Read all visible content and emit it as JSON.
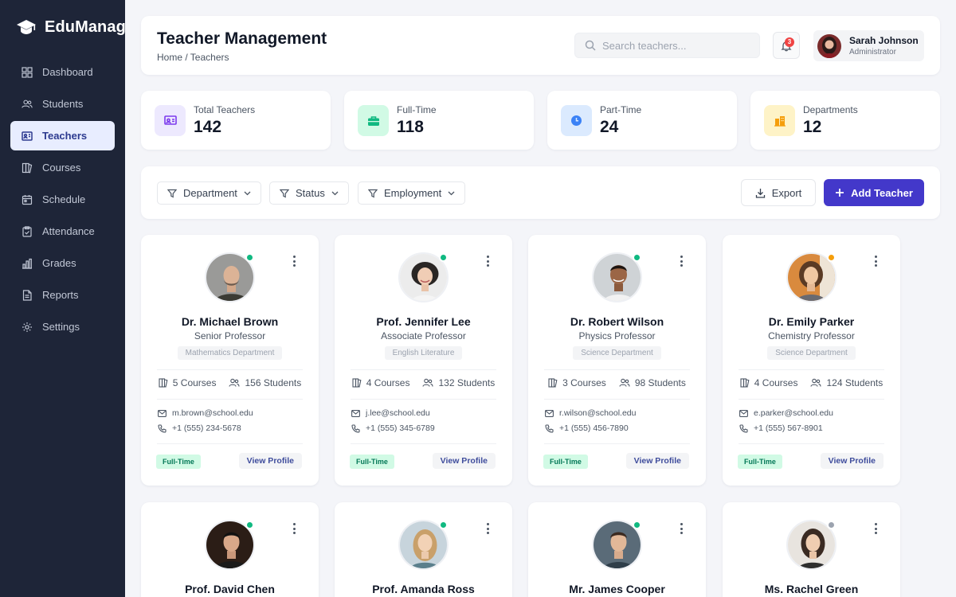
{
  "app": {
    "brand": "EduManage"
  },
  "sidebar": {
    "items": [
      {
        "label": "Dashboard",
        "icon": "dashboard-icon"
      },
      {
        "label": "Students",
        "icon": "users-icon"
      },
      {
        "label": "Teachers",
        "icon": "teacher-icon",
        "active": true
      },
      {
        "label": "Courses",
        "icon": "book-icon"
      },
      {
        "label": "Schedule",
        "icon": "calendar-icon"
      },
      {
        "label": "Attendance",
        "icon": "clipboard-icon"
      },
      {
        "label": "Grades",
        "icon": "bar-chart-icon"
      },
      {
        "label": "Reports",
        "icon": "document-icon"
      },
      {
        "label": "Settings",
        "icon": "gear-icon"
      }
    ]
  },
  "header": {
    "title": "Teacher Management",
    "breadcrumb": "Home / Teachers",
    "search_placeholder": "Search teachers...",
    "notifications": "3",
    "user": {
      "name": "Sarah Johnson",
      "role": "Administrator"
    }
  },
  "stats": [
    {
      "label": "Total Teachers",
      "value": "142",
      "icon": "teacher-board-icon",
      "color": "#ede9fe",
      "accent": "#7c3aed"
    },
    {
      "label": "Full-Time",
      "value": "118",
      "icon": "briefcase-icon",
      "color": "#d1fae5",
      "accent": "#10b981"
    },
    {
      "label": "Part-Time",
      "value": "24",
      "icon": "clock-icon",
      "color": "#dbeafe",
      "accent": "#3b82f6"
    },
    {
      "label": "Departments",
      "value": "12",
      "icon": "building-icon",
      "color": "#fef3c7",
      "accent": "#f59e0b"
    }
  ],
  "filters": {
    "department": "Department",
    "status": "Status",
    "employment": "Employment",
    "export": "Export",
    "add": "Add Teacher"
  },
  "teachers": [
    {
      "name": "Dr. Michael Brown",
      "title": "Senior Professor",
      "dept": "Mathematics Department",
      "courses": "5 Courses",
      "students": "156 Students",
      "email": "m.brown@school.edu",
      "phone": "+1 (555) 234-5678",
      "employment": "Full-Time",
      "action": "View Profile",
      "status_color": "#10b981"
    },
    {
      "name": "Prof. Jennifer Lee",
      "title": "Associate Professor",
      "dept": "English Literature",
      "courses": "4 Courses",
      "students": "132 Students",
      "email": "j.lee@school.edu",
      "phone": "+1 (555) 345-6789",
      "employment": "Full-Time",
      "action": "View Profile",
      "status_color": "#10b981"
    },
    {
      "name": "Dr. Robert Wilson",
      "title": "Physics Professor",
      "dept": "Science Department",
      "courses": "3 Courses",
      "students": "98 Students",
      "email": "r.wilson@school.edu",
      "phone": "+1 (555) 456-7890",
      "employment": "Full-Time",
      "action": "View Profile",
      "status_color": "#10b981"
    },
    {
      "name": "Dr. Emily Parker",
      "title": "Chemistry Professor",
      "dept": "Science Department",
      "courses": "4 Courses",
      "students": "124 Students",
      "email": "e.parker@school.edu",
      "phone": "+1 (555) 567-8901",
      "employment": "Full-Time",
      "action": "View Profile",
      "status_color": "#f59e0b"
    },
    {
      "name": "Prof. David Chen",
      "status_color": "#10b981"
    },
    {
      "name": "Prof. Amanda Ross",
      "status_color": "#10b981"
    },
    {
      "name": "Mr. James Cooper",
      "status_color": "#10b981"
    },
    {
      "name": "Ms. Rachel Green",
      "status_color": "#9ca3af"
    }
  ]
}
